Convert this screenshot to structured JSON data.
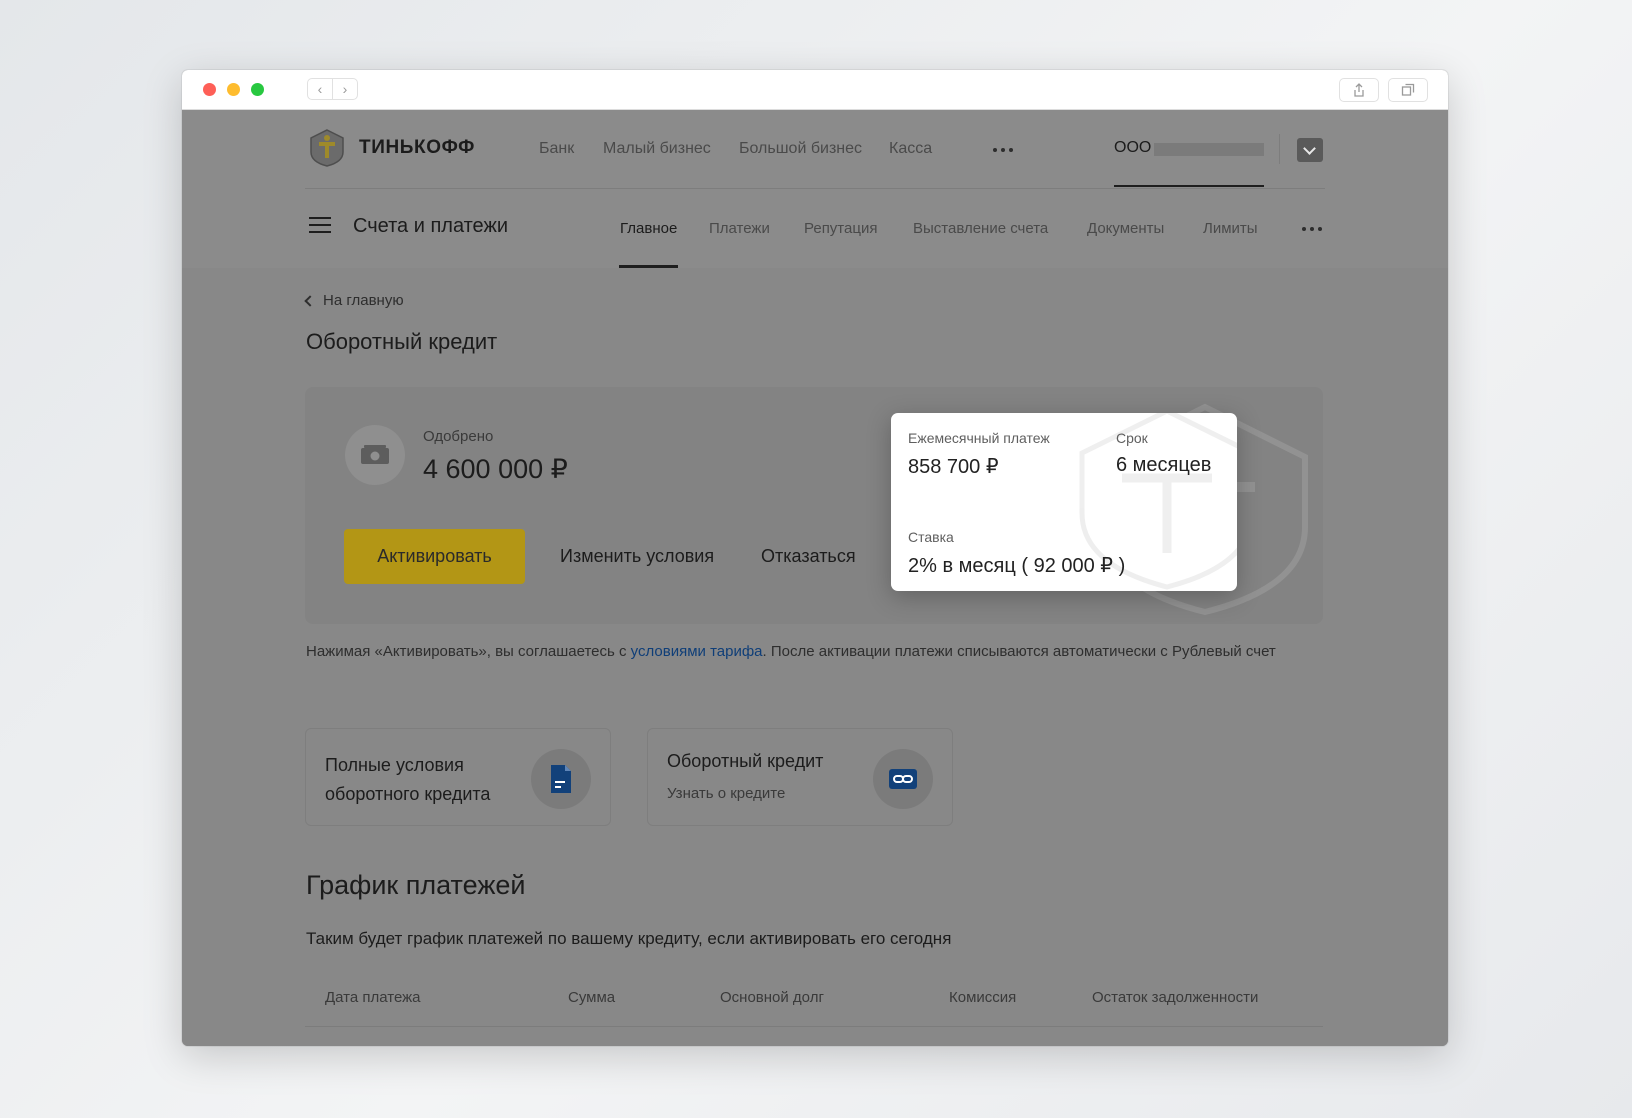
{
  "topnav": {
    "brand": "ТИНЬКОФФ",
    "items": [
      "Банк",
      "Малый бизнес",
      "Большой бизнес",
      "Касса"
    ],
    "org_prefix": "ООО"
  },
  "subnav": {
    "section_title": "Счета и платежи",
    "items": [
      "Главное",
      "Платежи",
      "Репутация",
      "Выставление счета",
      "Документы",
      "Лимиты"
    ],
    "active": "Главное"
  },
  "page": {
    "back_link": "На главную",
    "title": "Оборотный кредит"
  },
  "credit": {
    "approved_label": "Одобрено",
    "approved_value": "4 600 000 ₽",
    "activate_label": "Активировать",
    "change_label": "Изменить условия",
    "decline_label": "Отказаться"
  },
  "details": {
    "monthly_label": "Ежемесячный платеж",
    "monthly_value": "858 700 ₽",
    "term_label": "Срок",
    "term_value": "6 месяцев",
    "rate_label": "Ставка",
    "rate_value": "2% в месяц ( 92 000 ₽ )"
  },
  "legal": {
    "before": "Нажимая «Активировать», вы соглашаетесь с ",
    "link": "условиями тарифа",
    "after": ". После активации платежи списываются автоматически с Рублевый счет"
  },
  "cards": {
    "terms_line1": "Полные условия",
    "terms_line2": "оборотного кредита",
    "about_title": "Оборотный кредит",
    "about_sub": "Узнать о кредите"
  },
  "schedule": {
    "title": "График платежей",
    "description": "Таким будет график платежей по вашему кредиту, если активировать его сегодня",
    "columns": [
      "Дата платежа",
      "Сумма",
      "Основной долг",
      "Комиссия",
      "Остаток задолженности"
    ]
  },
  "colors": {
    "accent_yellow": "#ffdd2d",
    "link_blue": "#1c66c4",
    "icon_blue": "#1c66c4"
  },
  "icons": [
    "back-icon",
    "forward-icon",
    "share-icon",
    "tabs-icon",
    "brand-logo-icon",
    "more-icon",
    "mail-icon",
    "menu-icon",
    "chevron-left-icon",
    "cash-icon",
    "document-icon",
    "link-icon"
  ]
}
